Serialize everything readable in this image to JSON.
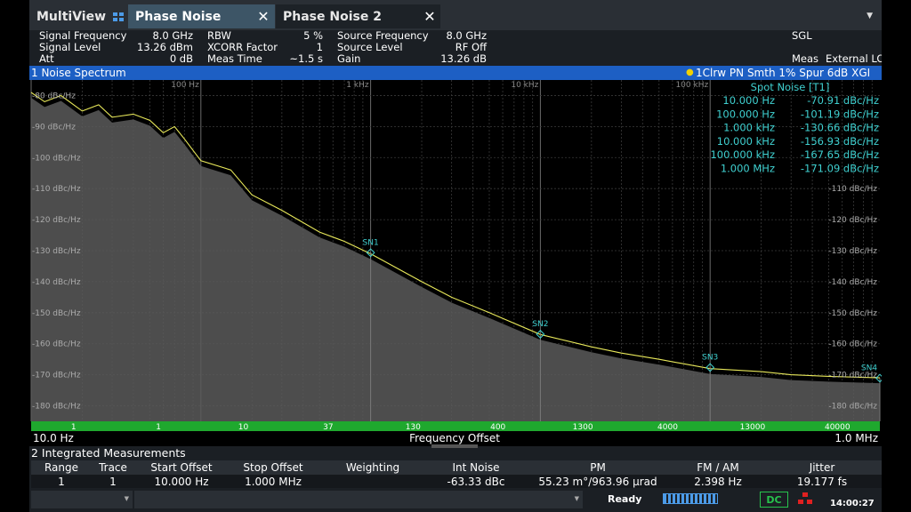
{
  "tabs": [
    {
      "label": "MultiView"
    },
    {
      "label": "Phase Noise"
    },
    {
      "label": "Phase Noise 2"
    }
  ],
  "close_glyph": "✕",
  "dropdown_glyph": "▼",
  "params": {
    "signal_frequency": {
      "label": "Signal Frequency",
      "value": "8.0 GHz"
    },
    "signal_level": {
      "label": "Signal Level",
      "value": "13.26 dBm"
    },
    "att": {
      "label": "Att",
      "value": "0 dB"
    },
    "rbw": {
      "label": "RBW",
      "value": "5 %"
    },
    "xcorr": {
      "label": "XCORR Factor",
      "value": "1"
    },
    "meas_time": {
      "label": "Meas Time",
      "value": "~1.5 s"
    },
    "source_frequency": {
      "label": "Source Frequency",
      "value": "8.0 GHz"
    },
    "source_level": {
      "label": "Source Level",
      "value": "RF Off"
    },
    "gain": {
      "label": "Gain",
      "value": "13.26 dB"
    },
    "sgl": "SGL",
    "meas_label": "Meas",
    "meas_value": "External LO"
  },
  "diagram": {
    "title": "1 Noise Spectrum",
    "trace_info": "1Clrw PN Smth 1% Spur 6dB XGI",
    "start": "10.0 Hz",
    "stop": "1.0 MHz",
    "xlabel": "Frequency Offset"
  },
  "spot_noise": {
    "title": "Spot Noise [T1]",
    "rows": [
      {
        "offset": "10.000 Hz",
        "value": "-70.91 dBc/Hz"
      },
      {
        "offset": "100.000 Hz",
        "value": "-101.19 dBc/Hz"
      },
      {
        "offset": "1.000 kHz",
        "value": "-130.66 dBc/Hz"
      },
      {
        "offset": "10.000 kHz",
        "value": "-156.93 dBc/Hz"
      },
      {
        "offset": "100.000 kHz",
        "value": "-167.65 dBc/Hz"
      },
      {
        "offset": "1.000 MHz",
        "value": "-171.09 dBc/Hz"
      }
    ]
  },
  "decade_labels": [
    "100 Hz",
    "1 kHz",
    "10 kHz",
    "100 kHz"
  ],
  "y_labels": [
    "-80 dBc/Hz",
    "-90 dBc/Hz",
    "-100 dBc/Hz",
    "-110 dBc/Hz",
    "-120 dBc/Hz",
    "-130 dBc/Hz",
    "-140 dBc/Hz",
    "-150 dBc/Hz",
    "-160 dBc/Hz",
    "-170 dBc/Hz",
    "-180 dBc/Hz"
  ],
  "right_labels": [
    "-110 dBc/Hz",
    "-120 dBc/Hz",
    "-130 dBc/Hz",
    "-140 dBc/Hz",
    "-150 dBc/Hz",
    "-160 dBc/Hz",
    "-170 dBc/Hz",
    "-180 dBc/Hz"
  ],
  "green_bar_labels": [
    "1",
    "1",
    "10",
    "37",
    "130",
    "400",
    "1300",
    "4000",
    "13000",
    "40000"
  ],
  "marker_labels": [
    "SN1",
    "SN2",
    "SN3",
    "SN4"
  ],
  "chart_data": {
    "type": "line",
    "x_scale": "log",
    "xlim": [
      10,
      1000000
    ],
    "ylim": [
      -185,
      -75
    ],
    "ylabel": "dBc/Hz",
    "xlabel": "Frequency Offset",
    "series": [
      {
        "name": "1Clrw PN Smth 1% Spur 6dB XGI",
        "color": "#e8e85a",
        "x": [
          10,
          12,
          15,
          20,
          25,
          30,
          40,
          50,
          60,
          70,
          80,
          100,
          150,
          200,
          300,
          500,
          700,
          1000,
          2000,
          3000,
          5000,
          10000,
          20000,
          30000,
          50000,
          100000,
          200000,
          300000,
          500000,
          1000000
        ],
        "y": [
          -79,
          -82,
          -80,
          -85,
          -83,
          -87,
          -86,
          -88,
          -92,
          -90,
          -94,
          -101,
          -104,
          -112,
          -117,
          -124,
          -127,
          -131,
          -140,
          -145,
          -150,
          -157,
          -161,
          -163,
          -165,
          -168,
          -169,
          -170,
          -170.5,
          -171
        ]
      }
    ],
    "markers": [
      {
        "name": "SN1",
        "x": 1000,
        "y": -130.66
      },
      {
        "name": "SN2",
        "x": 10000,
        "y": -156.93
      },
      {
        "name": "SN3",
        "x": 100000,
        "y": -167.65
      },
      {
        "name": "SN4",
        "x": 1000000,
        "y": -171.09
      }
    ]
  },
  "integrated": {
    "title": "2 Integrated Measurements",
    "headers": [
      "Range",
      "Trace",
      "Start Offset",
      "Stop Offset",
      "Weighting",
      "Int Noise",
      "PM",
      "FM / AM",
      "Jitter"
    ],
    "row": [
      "1",
      "1",
      "10.000 Hz",
      "1.000 MHz",
      "",
      "-63.33 dBc",
      "55.23 m°/963.96 µrad",
      "2.398 Hz",
      "19.177 fs"
    ]
  },
  "status": {
    "ready": "Ready",
    "dc": "DC",
    "time": "14:00:27"
  },
  "colors": {
    "accent": "#1d5fc4",
    "trace": "#e8e85a",
    "marker": "#3fd0d0",
    "green": "#1fa82e"
  }
}
